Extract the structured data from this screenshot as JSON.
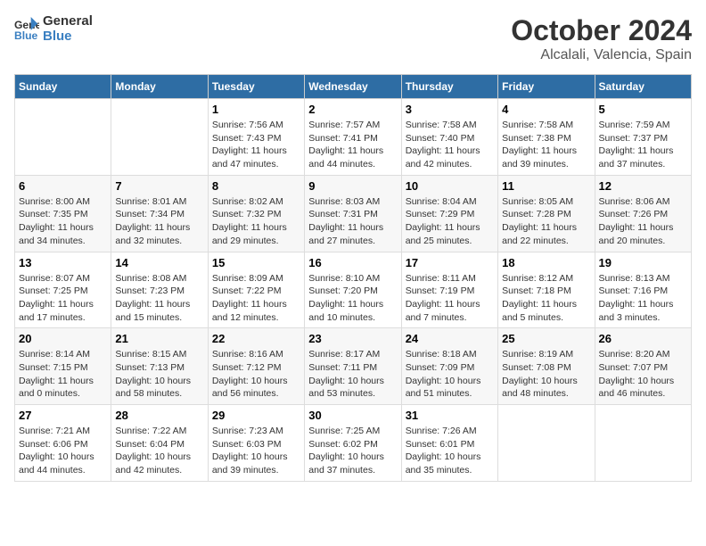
{
  "logo": {
    "line1": "General",
    "line2": "Blue"
  },
  "title": "October 2024",
  "subtitle": "Alcalali, Valencia, Spain",
  "header_days": [
    "Sunday",
    "Monday",
    "Tuesday",
    "Wednesday",
    "Thursday",
    "Friday",
    "Saturday"
  ],
  "weeks": [
    [
      {
        "day": "",
        "info": ""
      },
      {
        "day": "",
        "info": ""
      },
      {
        "day": "1",
        "info": "Sunrise: 7:56 AM\nSunset: 7:43 PM\nDaylight: 11 hours and 47 minutes."
      },
      {
        "day": "2",
        "info": "Sunrise: 7:57 AM\nSunset: 7:41 PM\nDaylight: 11 hours and 44 minutes."
      },
      {
        "day": "3",
        "info": "Sunrise: 7:58 AM\nSunset: 7:40 PM\nDaylight: 11 hours and 42 minutes."
      },
      {
        "day": "4",
        "info": "Sunrise: 7:58 AM\nSunset: 7:38 PM\nDaylight: 11 hours and 39 minutes."
      },
      {
        "day": "5",
        "info": "Sunrise: 7:59 AM\nSunset: 7:37 PM\nDaylight: 11 hours and 37 minutes."
      }
    ],
    [
      {
        "day": "6",
        "info": "Sunrise: 8:00 AM\nSunset: 7:35 PM\nDaylight: 11 hours and 34 minutes."
      },
      {
        "day": "7",
        "info": "Sunrise: 8:01 AM\nSunset: 7:34 PM\nDaylight: 11 hours and 32 minutes."
      },
      {
        "day": "8",
        "info": "Sunrise: 8:02 AM\nSunset: 7:32 PM\nDaylight: 11 hours and 29 minutes."
      },
      {
        "day": "9",
        "info": "Sunrise: 8:03 AM\nSunset: 7:31 PM\nDaylight: 11 hours and 27 minutes."
      },
      {
        "day": "10",
        "info": "Sunrise: 8:04 AM\nSunset: 7:29 PM\nDaylight: 11 hours and 25 minutes."
      },
      {
        "day": "11",
        "info": "Sunrise: 8:05 AM\nSunset: 7:28 PM\nDaylight: 11 hours and 22 minutes."
      },
      {
        "day": "12",
        "info": "Sunrise: 8:06 AM\nSunset: 7:26 PM\nDaylight: 11 hours and 20 minutes."
      }
    ],
    [
      {
        "day": "13",
        "info": "Sunrise: 8:07 AM\nSunset: 7:25 PM\nDaylight: 11 hours and 17 minutes."
      },
      {
        "day": "14",
        "info": "Sunrise: 8:08 AM\nSunset: 7:23 PM\nDaylight: 11 hours and 15 minutes."
      },
      {
        "day": "15",
        "info": "Sunrise: 8:09 AM\nSunset: 7:22 PM\nDaylight: 11 hours and 12 minutes."
      },
      {
        "day": "16",
        "info": "Sunrise: 8:10 AM\nSunset: 7:20 PM\nDaylight: 11 hours and 10 minutes."
      },
      {
        "day": "17",
        "info": "Sunrise: 8:11 AM\nSunset: 7:19 PM\nDaylight: 11 hours and 7 minutes."
      },
      {
        "day": "18",
        "info": "Sunrise: 8:12 AM\nSunset: 7:18 PM\nDaylight: 11 hours and 5 minutes."
      },
      {
        "day": "19",
        "info": "Sunrise: 8:13 AM\nSunset: 7:16 PM\nDaylight: 11 hours and 3 minutes."
      }
    ],
    [
      {
        "day": "20",
        "info": "Sunrise: 8:14 AM\nSunset: 7:15 PM\nDaylight: 11 hours and 0 minutes."
      },
      {
        "day": "21",
        "info": "Sunrise: 8:15 AM\nSunset: 7:13 PM\nDaylight: 10 hours and 58 minutes."
      },
      {
        "day": "22",
        "info": "Sunrise: 8:16 AM\nSunset: 7:12 PM\nDaylight: 10 hours and 56 minutes."
      },
      {
        "day": "23",
        "info": "Sunrise: 8:17 AM\nSunset: 7:11 PM\nDaylight: 10 hours and 53 minutes."
      },
      {
        "day": "24",
        "info": "Sunrise: 8:18 AM\nSunset: 7:09 PM\nDaylight: 10 hours and 51 minutes."
      },
      {
        "day": "25",
        "info": "Sunrise: 8:19 AM\nSunset: 7:08 PM\nDaylight: 10 hours and 48 minutes."
      },
      {
        "day": "26",
        "info": "Sunrise: 8:20 AM\nSunset: 7:07 PM\nDaylight: 10 hours and 46 minutes."
      }
    ],
    [
      {
        "day": "27",
        "info": "Sunrise: 7:21 AM\nSunset: 6:06 PM\nDaylight: 10 hours and 44 minutes."
      },
      {
        "day": "28",
        "info": "Sunrise: 7:22 AM\nSunset: 6:04 PM\nDaylight: 10 hours and 42 minutes."
      },
      {
        "day": "29",
        "info": "Sunrise: 7:23 AM\nSunset: 6:03 PM\nDaylight: 10 hours and 39 minutes."
      },
      {
        "day": "30",
        "info": "Sunrise: 7:25 AM\nSunset: 6:02 PM\nDaylight: 10 hours and 37 minutes."
      },
      {
        "day": "31",
        "info": "Sunrise: 7:26 AM\nSunset: 6:01 PM\nDaylight: 10 hours and 35 minutes."
      },
      {
        "day": "",
        "info": ""
      },
      {
        "day": "",
        "info": ""
      }
    ]
  ]
}
